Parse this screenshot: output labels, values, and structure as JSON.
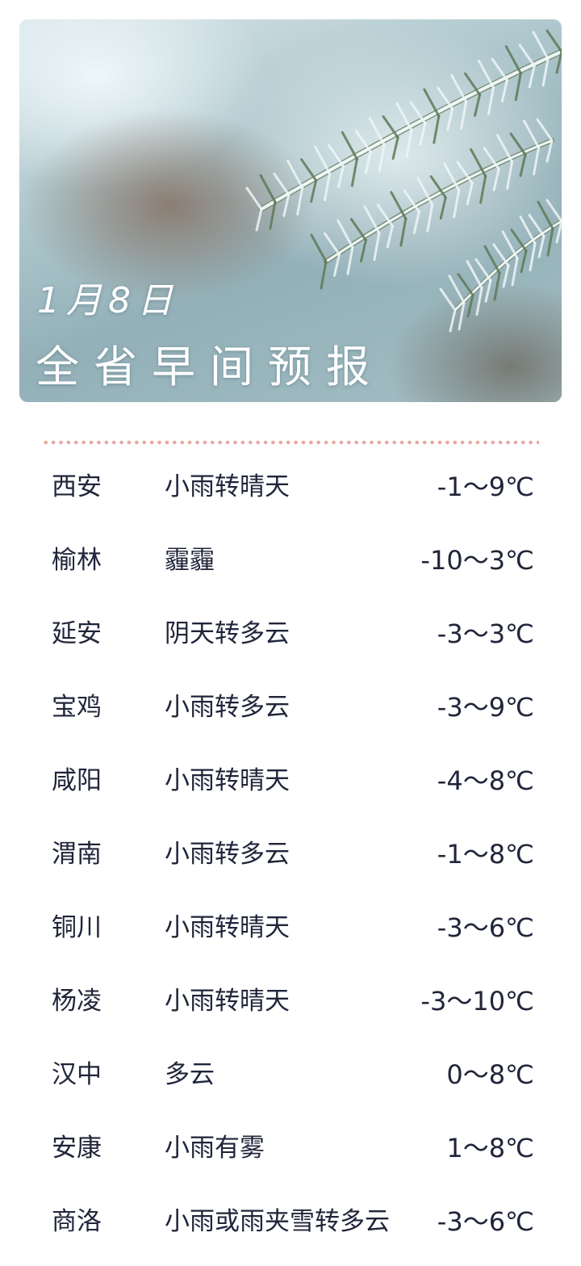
{
  "header": {
    "date": "1月8日",
    "title": "全省早间预报"
  },
  "forecast": [
    {
      "city": "西安",
      "condition": "小雨转晴天",
      "temp": "-1～9℃"
    },
    {
      "city": "榆林",
      "condition": "霾霾",
      "temp": "-10～3℃"
    },
    {
      "city": "延安",
      "condition": "阴天转多云",
      "temp": "-3～3℃"
    },
    {
      "city": "宝鸡",
      "condition": "小雨转多云",
      "temp": "-3～9℃"
    },
    {
      "city": "咸阳",
      "condition": "小雨转晴天",
      "temp": "-4～8℃"
    },
    {
      "city": "渭南",
      "condition": "小雨转多云",
      "temp": "-1～8℃"
    },
    {
      "city": "铜川",
      "condition": "小雨转晴天",
      "temp": "-3～6℃"
    },
    {
      "city": "杨凌",
      "condition": "小雨转晴天",
      "temp": "-3～10℃"
    },
    {
      "city": "汉中",
      "condition": "多云",
      "temp": "0～8℃"
    },
    {
      "city": "安康",
      "condition": "小雨有雾",
      "temp": "1～8℃"
    },
    {
      "city": "商洛",
      "condition": "小雨或雨夹雪转多云",
      "temp": "-3～6℃"
    }
  ],
  "colors": {
    "text": "#20253a",
    "divider_dots": "#e9a9a2",
    "hero_text": "#ffffff"
  }
}
